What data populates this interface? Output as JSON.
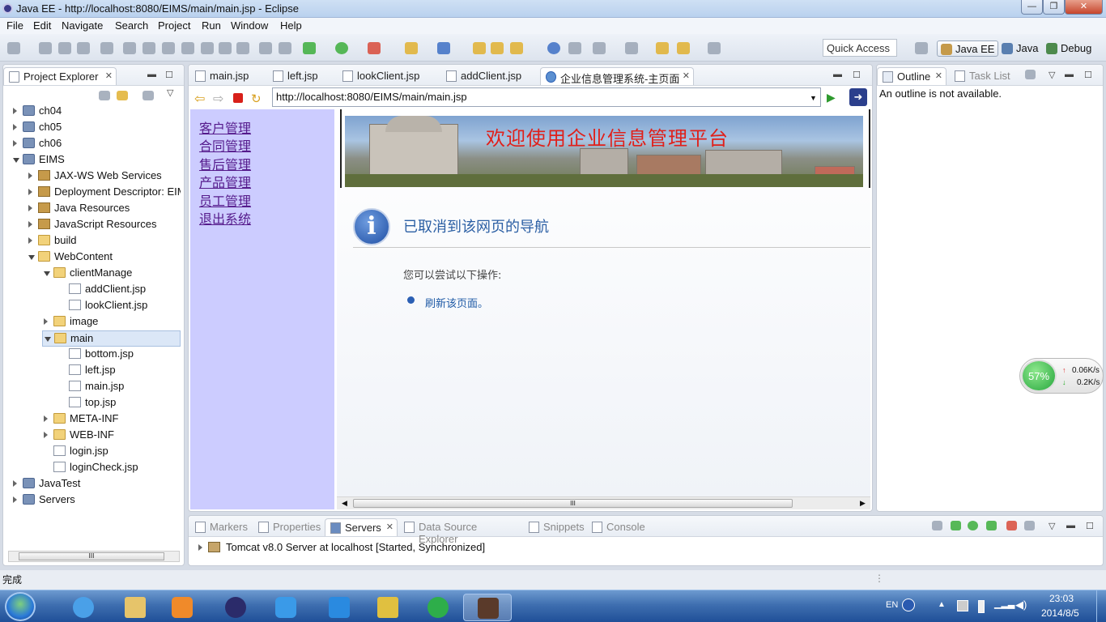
{
  "window": {
    "title": "Java EE - http://localhost:8080/EIMS/main/main.jsp - Eclipse",
    "buttons": [
      "—",
      "❐",
      "✕"
    ]
  },
  "menu": [
    "File",
    "Edit",
    "Navigate",
    "Search",
    "Project",
    "Run",
    "Window",
    "Help"
  ],
  "quick_access": "Quick Access",
  "perspectives": [
    "Java EE",
    "Java",
    "Debug"
  ],
  "project_explorer": {
    "title": "Project Explorer",
    "close": "✕",
    "items": [
      {
        "label": "ch04",
        "level": 0,
        "state": "closed",
        "icon": "project-icon"
      },
      {
        "label": "ch05",
        "level": 0,
        "state": "closed",
        "icon": "project-icon"
      },
      {
        "label": "ch06",
        "level": 0,
        "state": "closed",
        "icon": "project-icon"
      },
      {
        "label": "EIMS",
        "level": 0,
        "state": "open",
        "icon": "project-icon"
      },
      {
        "label": "JAX-WS Web Services",
        "level": 1,
        "state": "closed",
        "icon": "lib-icon"
      },
      {
        "label": "Deployment Descriptor: EIMS",
        "level": 1,
        "state": "closed",
        "icon": "lib-icon"
      },
      {
        "label": "Java Resources",
        "level": 1,
        "state": "closed",
        "icon": "lib-icon"
      },
      {
        "label": "JavaScript Resources",
        "level": 1,
        "state": "closed",
        "icon": "lib-icon"
      },
      {
        "label": "build",
        "level": 1,
        "state": "closed",
        "icon": "folder-icon"
      },
      {
        "label": "WebContent",
        "level": 1,
        "state": "open",
        "icon": "folder-icon"
      },
      {
        "label": "clientManage",
        "level": 2,
        "state": "open",
        "icon": "folder-icon"
      },
      {
        "label": "addClient.jsp",
        "level": 3,
        "state": "leaf",
        "icon": "jsp-file-icon"
      },
      {
        "label": "lookClient.jsp",
        "level": 3,
        "state": "leaf",
        "icon": "jsp-file-icon"
      },
      {
        "label": "image",
        "level": 2,
        "state": "closed",
        "icon": "folder-icon"
      },
      {
        "label": "main",
        "level": 2,
        "state": "open",
        "icon": "folder-icon",
        "selected": true
      },
      {
        "label": "bottom.jsp",
        "level": 3,
        "state": "leaf",
        "icon": "jsp-file-icon"
      },
      {
        "label": "left.jsp",
        "level": 3,
        "state": "leaf",
        "icon": "jsp-file-icon"
      },
      {
        "label": "main.jsp",
        "level": 3,
        "state": "leaf",
        "icon": "jsp-file-icon"
      },
      {
        "label": "top.jsp",
        "level": 3,
        "state": "leaf",
        "icon": "jsp-file-icon"
      },
      {
        "label": "META-INF",
        "level": 2,
        "state": "closed",
        "icon": "folder-icon"
      },
      {
        "label": "WEB-INF",
        "level": 2,
        "state": "closed",
        "icon": "folder-icon"
      },
      {
        "label": "login.jsp",
        "level": 2,
        "state": "leaf",
        "icon": "jsp-file-icon"
      },
      {
        "label": "loginCheck.jsp",
        "level": 2,
        "state": "leaf",
        "icon": "jsp-file-icon"
      },
      {
        "label": "JavaTest",
        "level": 0,
        "state": "closed",
        "icon": "project-icon"
      },
      {
        "label": "Servers",
        "level": 0,
        "state": "closed",
        "icon": "project-icon"
      }
    ],
    "hscroll_grip": "III"
  },
  "editor": {
    "tabs": [
      {
        "label": "main.jsp"
      },
      {
        "label": "left.jsp"
      },
      {
        "label": "lookClient.jsp"
      },
      {
        "label": "addClient.jsp"
      },
      {
        "label": "企业信息管理系统-主页面",
        "active": true
      }
    ],
    "close": "✕",
    "url": "http://localhost:8080/EIMS/main/main.jsp",
    "left_links": [
      "客户管理",
      "合同管理",
      "售后管理",
      "产品管理",
      "员工管理",
      "退出系统"
    ],
    "banner_title": "欢迎使用企业信息管理平台",
    "nav_error": {
      "heading": "已取消到该网页的导航",
      "hint": "您可以尝试以下操作:",
      "action": "刷新该页面。"
    },
    "hscroll_grip": "III"
  },
  "outline": {
    "tabs": [
      "Outline",
      "Task List"
    ],
    "message": "An outline is not available."
  },
  "bottom_panel": {
    "tabs": [
      "Markers",
      "Properties",
      "Servers",
      "Data Source Explorer",
      "Snippets",
      "Console"
    ],
    "active_tab": "Servers",
    "server_row": "Tomcat v8.0 Server at localhost  [Started, Synchronized]"
  },
  "net_widget": {
    "percent": "57%",
    "up": "0.06K/s",
    "down": "0.2K/s"
  },
  "status": {
    "text": "完成"
  },
  "taskbar": {
    "lang": "EN",
    "time": "23:03",
    "date": "2014/8/5"
  },
  "colors": {
    "left_frame": "#ccccff",
    "link": "#551a8b",
    "banner_title": "#e0201a",
    "info_blue": "#2b5fb4"
  }
}
